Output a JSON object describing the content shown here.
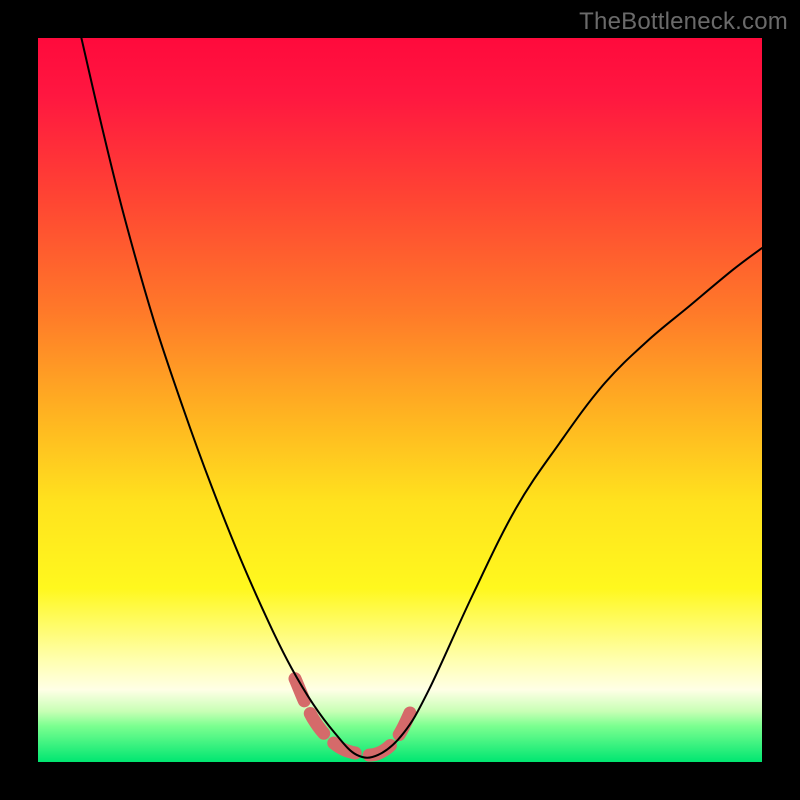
{
  "watermark": {
    "text": "TheBottleneck.com"
  },
  "chart_data": {
    "type": "line",
    "title": "",
    "xlabel": "",
    "ylabel": "",
    "xlim": [
      0,
      1
    ],
    "ylim": [
      0,
      1
    ],
    "background_gradient": {
      "direction": "top-to-bottom",
      "stops": [
        {
          "pos": 0.0,
          "color": "#ff0a3c"
        },
        {
          "pos": 0.08,
          "color": "#ff1740"
        },
        {
          "pos": 0.22,
          "color": "#ff4433"
        },
        {
          "pos": 0.38,
          "color": "#ff7a29"
        },
        {
          "pos": 0.52,
          "color": "#ffb321"
        },
        {
          "pos": 0.64,
          "color": "#ffe21e"
        },
        {
          "pos": 0.76,
          "color": "#fff81e"
        },
        {
          "pos": 0.86,
          "color": "#ffffb0"
        },
        {
          "pos": 0.9,
          "color": "#ffffe6"
        },
        {
          "pos": 0.93,
          "color": "#c8ffb5"
        },
        {
          "pos": 0.95,
          "color": "#7cff90"
        },
        {
          "pos": 1.0,
          "color": "#00e671"
        }
      ]
    },
    "series": [
      {
        "name": "bottleneck-curve",
        "color": "#000000",
        "stroke_width": 2,
        "x": [
          0.06,
          0.09,
          0.12,
          0.16,
          0.2,
          0.24,
          0.28,
          0.32,
          0.35,
          0.38,
          0.41,
          0.44,
          0.47,
          0.505,
          0.54,
          0.6,
          0.66,
          0.72,
          0.78,
          0.84,
          0.9,
          0.96,
          1.0
        ],
        "y": [
          1.0,
          0.87,
          0.75,
          0.61,
          0.49,
          0.38,
          0.28,
          0.19,
          0.13,
          0.08,
          0.04,
          0.01,
          0.01,
          0.04,
          0.1,
          0.23,
          0.35,
          0.44,
          0.52,
          0.58,
          0.63,
          0.68,
          0.71
        ]
      }
    ],
    "annotations": [
      {
        "name": "valley-highlight",
        "type": "marker-arc",
        "color": "#d56a6a",
        "stroke_width": 13,
        "dash": [
          24,
          14
        ],
        "points_x": [
          0.355,
          0.38,
          0.41,
          0.44,
          0.47,
          0.497,
          0.52
        ],
        "points_y": [
          0.115,
          0.06,
          0.025,
          0.012,
          0.012,
          0.035,
          0.082
        ]
      }
    ]
  }
}
